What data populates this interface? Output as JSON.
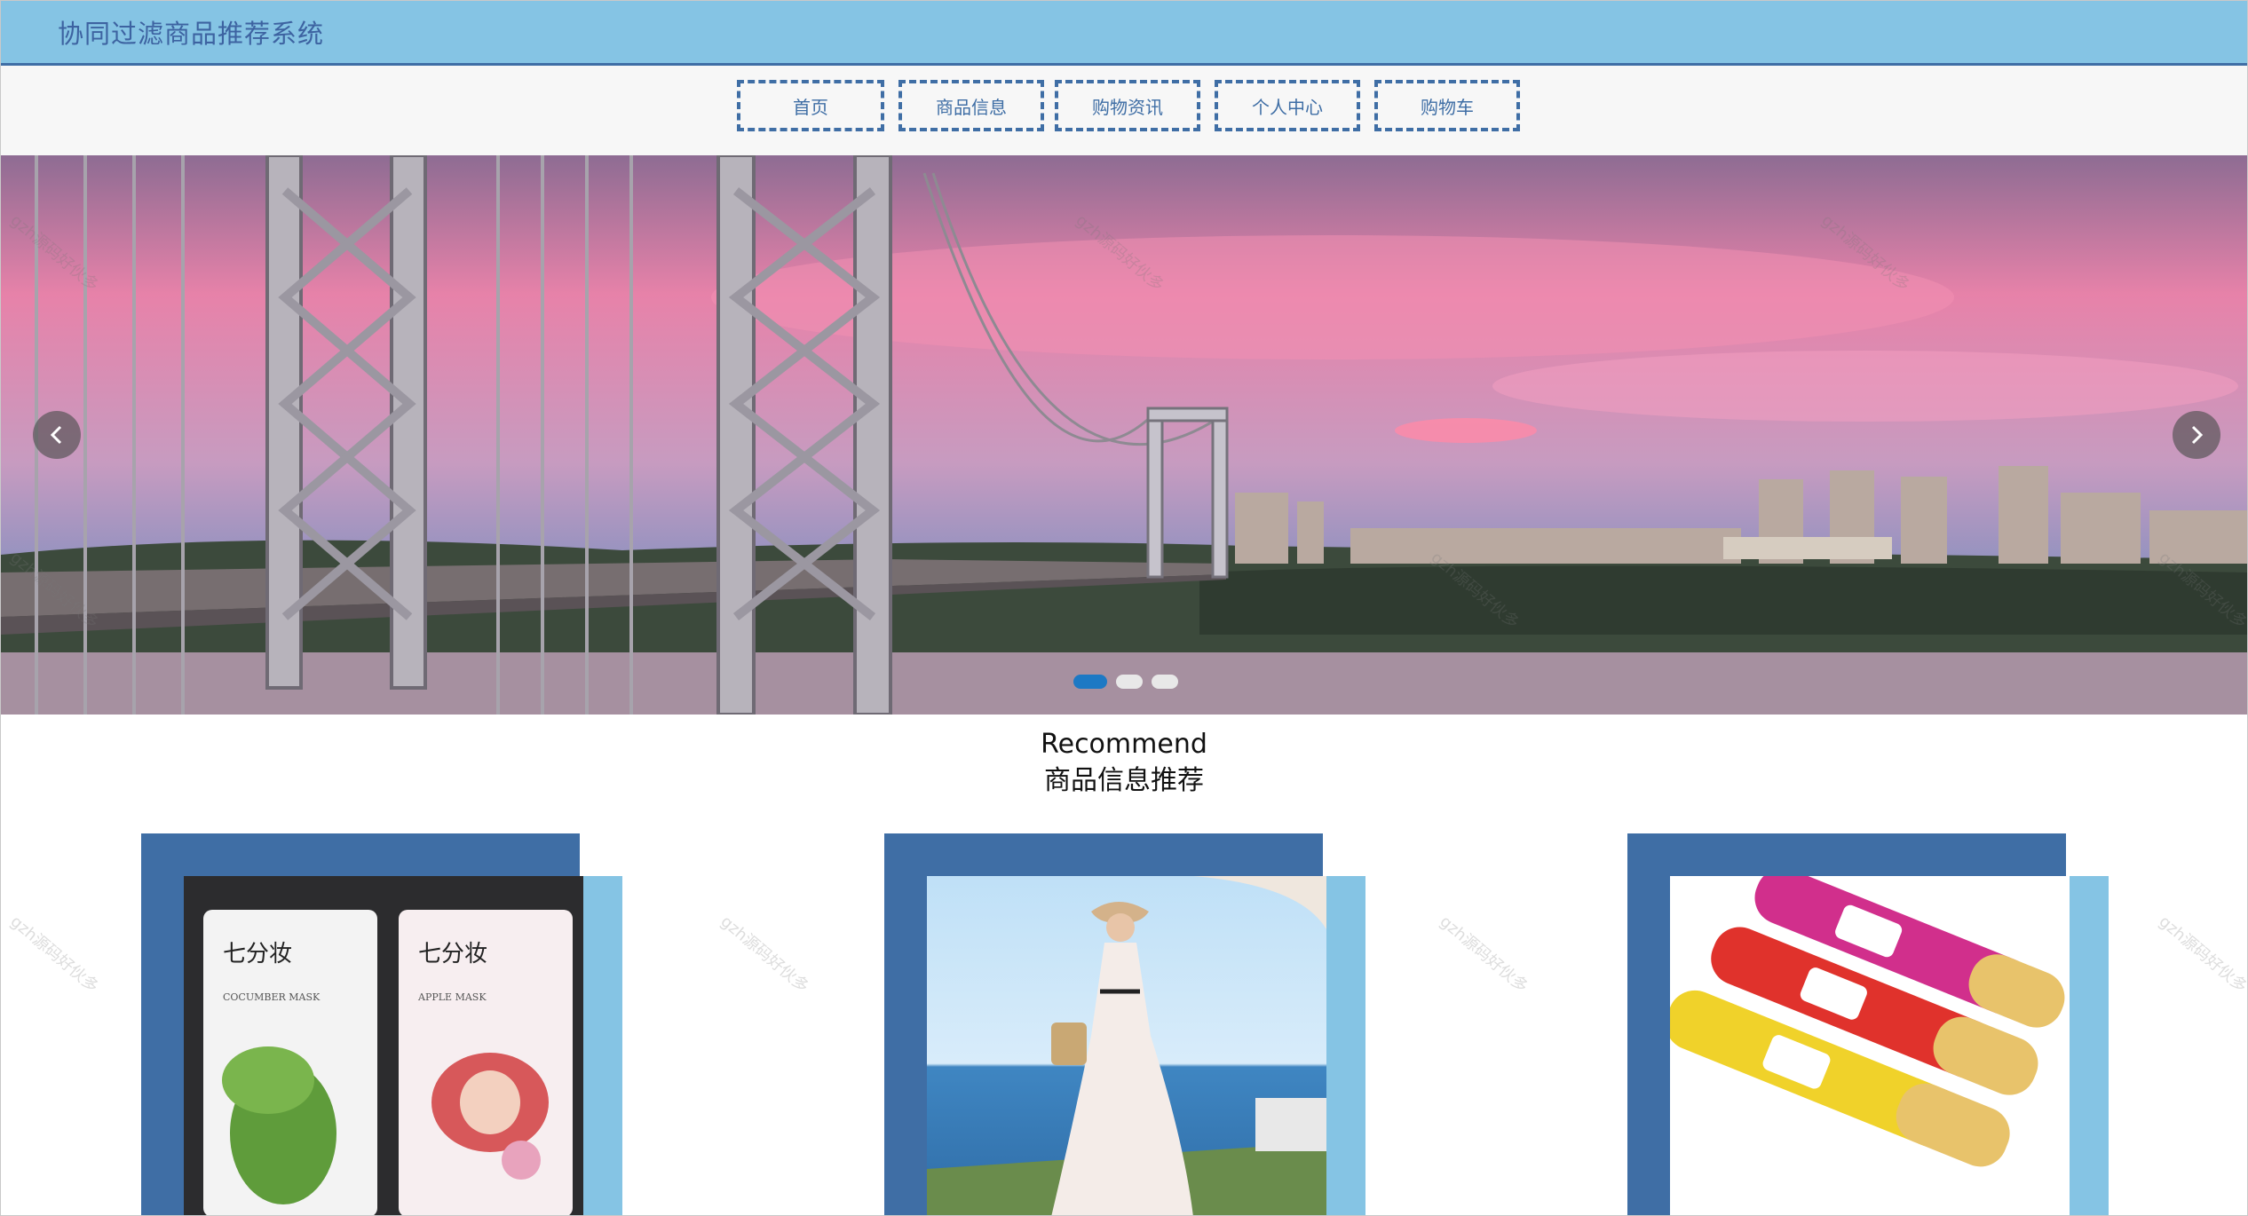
{
  "app": {
    "title": "协同过滤商品推荐系统"
  },
  "nav": {
    "items": [
      {
        "label": "首页"
      },
      {
        "label": "商品信息"
      },
      {
        "label": "购物资讯"
      },
      {
        "label": "个人中心"
      },
      {
        "label": "购物车"
      }
    ]
  },
  "carousel": {
    "slide_count": 3,
    "active_index": 0
  },
  "recommend": {
    "title_en": "Recommend",
    "title_cn": "商品信息推荐"
  },
  "products": [
    {
      "mask_left_brand": "七分妆",
      "mask_left_name": "COCUMBER MASK",
      "mask_right_brand": "七分妆",
      "mask_right_name": "APPLE MASK"
    },
    {
      "image": "dress-photo"
    },
    {
      "image": "chips-photo"
    }
  ],
  "watermark": "gzh源码好伙多",
  "colors": {
    "header_bg": "#85c4e4",
    "brand_blue": "#3f6ea5",
    "active_dot": "#1d79c4"
  }
}
